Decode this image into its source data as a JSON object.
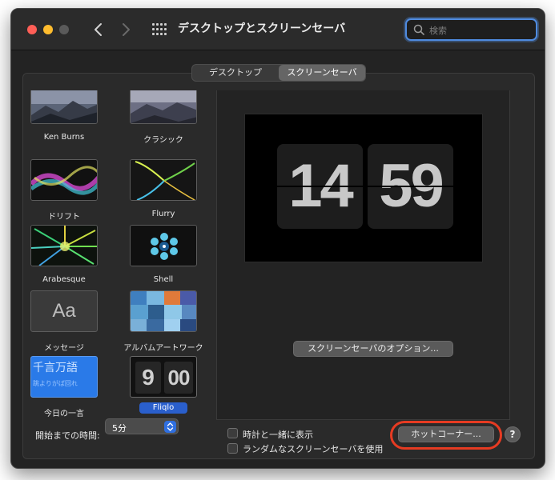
{
  "window": {
    "title": "デスクトップとスクリーンセーバ",
    "search": {
      "placeholder": "検索",
      "value": ""
    }
  },
  "tabs": [
    {
      "label": "デスクトップ",
      "selected": false
    },
    {
      "label": "スクリーンセーバ",
      "selected": true
    }
  ],
  "modules": [
    {
      "label": "Ken Burns",
      "selected": false
    },
    {
      "label": "クラシック",
      "selected": false
    },
    {
      "label": "ドリフト",
      "selected": false
    },
    {
      "label": "Flurry",
      "selected": false
    },
    {
      "label": "Arabesque",
      "selected": false
    },
    {
      "label": "Shell",
      "selected": false
    },
    {
      "label": "メッセージ",
      "selected": false,
      "thumb_text": "Aa"
    },
    {
      "label": "アルバムアートワーク",
      "selected": false
    },
    {
      "label": "今日の一言",
      "selected": false,
      "thumb_text": "千言万語",
      "thumb_text2": "跳よりがば回れ"
    },
    {
      "label": "Fliqlo",
      "selected": true,
      "thumb_hour": "9",
      "thumb_minute": "00"
    }
  ],
  "preview": {
    "hour": "14",
    "minute": "59"
  },
  "options_button": "スクリーンセーバのオプション...",
  "start_after": {
    "label": "開始までの時間:",
    "value": "5分"
  },
  "checkboxes": [
    {
      "label": "時計と一緒に表示",
      "checked": false
    },
    {
      "label": "ランダムなスクリーンセーバを使用",
      "checked": false
    }
  ],
  "hot_corners_button": "ホットコーナー...",
  "help_label": "?",
  "colors": {
    "accent": "#2f6fe0",
    "highlight_ring": "#e63b22",
    "window_bg": "#232323"
  }
}
